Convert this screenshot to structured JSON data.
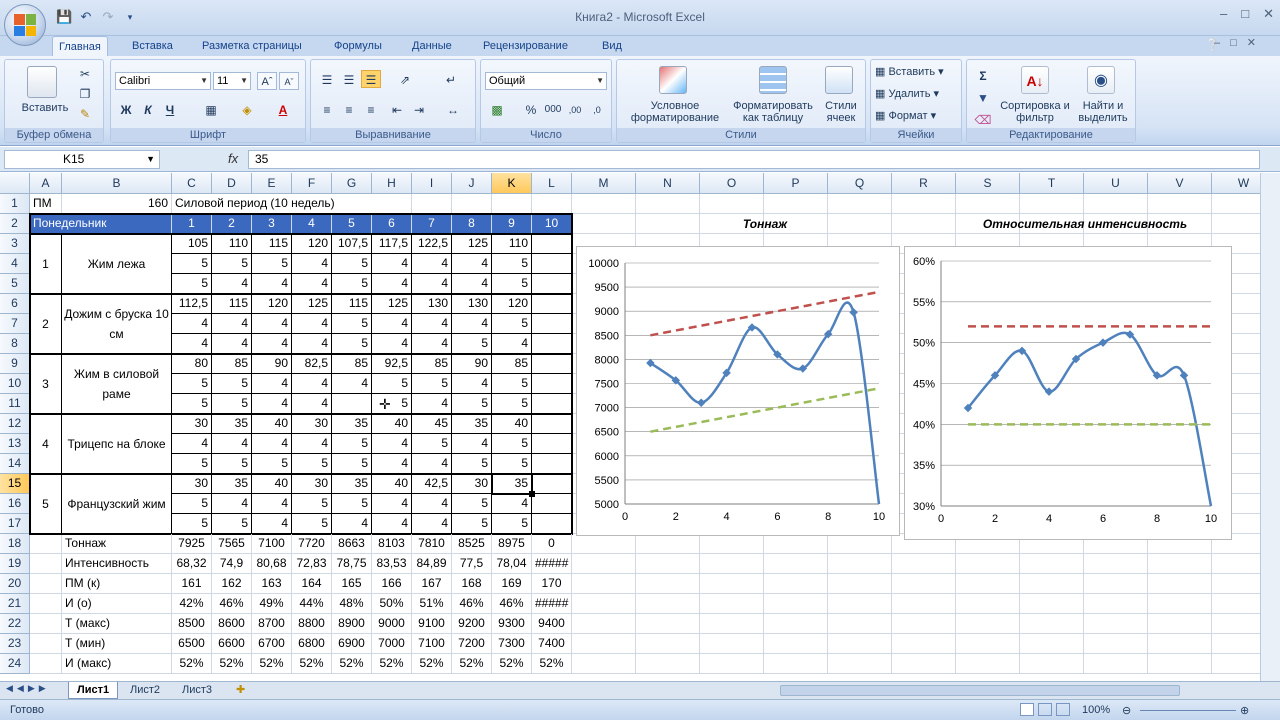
{
  "window": {
    "title": "Книга2 - Microsoft Excel"
  },
  "tabs": [
    "Главная",
    "Вставка",
    "Разметка страницы",
    "Формулы",
    "Данные",
    "Рецензирование",
    "Вид"
  ],
  "ribbon": {
    "clipboard": {
      "label": "Буфер обмена",
      "paste": "Вставить"
    },
    "font": {
      "label": "Шрифт",
      "name": "Calibri",
      "size": "11",
      "bold": "Ж",
      "italic": "К",
      "underline": "Ч"
    },
    "alignment": {
      "label": "Выравнивание"
    },
    "number": {
      "label": "Число",
      "format": "Общий"
    },
    "styles": {
      "label": "Стили",
      "conditional": "Условное форматирование",
      "table": "Форматировать как таблицу",
      "cell": "Стили ячеек"
    },
    "cells": {
      "label": "Ячейки",
      "insert": "Вставить",
      "delete": "Удалить",
      "format": "Формат"
    },
    "editing": {
      "label": "Редактирование",
      "sort": "Сортировка и фильтр",
      "find": "Найти и выделить"
    }
  },
  "formula_bar": {
    "name": "K15",
    "fx": "fx",
    "value": "35"
  },
  "columns": [
    "A",
    "B",
    "C",
    "D",
    "E",
    "F",
    "G",
    "H",
    "I",
    "J",
    "K",
    "L",
    "M",
    "N",
    "O",
    "P",
    "Q",
    "R",
    "S",
    "T",
    "U",
    "V",
    "W"
  ],
  "rows": [
    "1",
    "2",
    "3",
    "4",
    "5",
    "6",
    "7",
    "8",
    "9",
    "10",
    "11",
    "12",
    "13",
    "14",
    "15",
    "16",
    "17",
    "18",
    "19",
    "20",
    "21",
    "22",
    "23",
    "24"
  ],
  "sheet": {
    "r1": {
      "a": "ПМ",
      "b": "160",
      "c": "Силовой период (10 недель)"
    },
    "header": {
      "a": "Понедельник",
      "weeks": [
        "1",
        "2",
        "3",
        "4",
        "5",
        "6",
        "7",
        "8",
        "9",
        "10"
      ]
    },
    "exercises": [
      {
        "num": "1",
        "name": "Жим лежа",
        "rows": [
          [
            "105",
            "110",
            "115",
            "120",
            "107,5",
            "117,5",
            "122,5",
            "125",
            "110",
            ""
          ],
          [
            "5",
            "5",
            "5",
            "4",
            "5",
            "4",
            "4",
            "4",
            "5",
            ""
          ],
          [
            "5",
            "4",
            "4",
            "4",
            "5",
            "4",
            "4",
            "4",
            "5",
            ""
          ]
        ]
      },
      {
        "num": "2",
        "name": "Дожим с бруска 10 см",
        "rows": [
          [
            "112,5",
            "115",
            "120",
            "125",
            "115",
            "125",
            "130",
            "130",
            "120",
            ""
          ],
          [
            "4",
            "4",
            "4",
            "4",
            "5",
            "4",
            "4",
            "4",
            "5",
            ""
          ],
          [
            "4",
            "4",
            "4",
            "4",
            "5",
            "4",
            "4",
            "5",
            "4",
            ""
          ]
        ]
      },
      {
        "num": "3",
        "name": "Жим в силовой раме",
        "rows": [
          [
            "80",
            "85",
            "90",
            "82,5",
            "85",
            "92,5",
            "85",
            "90",
            "85",
            ""
          ],
          [
            "5",
            "5",
            "4",
            "4",
            "4",
            "5",
            "5",
            "4",
            "5",
            ""
          ],
          [
            "5",
            "5",
            "4",
            "4",
            "",
            "5",
            "4",
            "5",
            "5",
            ""
          ]
        ]
      },
      {
        "num": "4",
        "name": "Трицепс на блоке",
        "rows": [
          [
            "30",
            "35",
            "40",
            "30",
            "35",
            "40",
            "45",
            "35",
            "40",
            ""
          ],
          [
            "4",
            "4",
            "4",
            "4",
            "5",
            "4",
            "5",
            "4",
            "5",
            ""
          ],
          [
            "5",
            "5",
            "5",
            "5",
            "5",
            "4",
            "4",
            "5",
            "5",
            ""
          ]
        ]
      },
      {
        "num": "5",
        "name": "Французский жим",
        "rows": [
          [
            "30",
            "35",
            "40",
            "30",
            "35",
            "40",
            "42,5",
            "30",
            "35",
            ""
          ],
          [
            "5",
            "4",
            "4",
            "5",
            "5",
            "4",
            "4",
            "5",
            "4",
            ""
          ],
          [
            "5",
            "5",
            "4",
            "5",
            "4",
            "4",
            "4",
            "5",
            "5",
            ""
          ]
        ]
      }
    ],
    "summary": [
      {
        "label": "Тоннаж",
        "values": [
          "7925",
          "7565",
          "7100",
          "7720",
          "8663",
          "8103",
          "7810",
          "8525",
          "8975",
          "0"
        ]
      },
      {
        "label": "Интенсивность",
        "values": [
          "68,32",
          "74,9",
          "80,68",
          "72,83",
          "78,75",
          "83,53",
          "84,89",
          "77,5",
          "78,04",
          "#####"
        ]
      },
      {
        "label": "ПМ (к)",
        "values": [
          "161",
          "162",
          "163",
          "164",
          "165",
          "166",
          "167",
          "168",
          "169",
          "170"
        ]
      },
      {
        "label": "И (о)",
        "values": [
          "42%",
          "46%",
          "49%",
          "44%",
          "48%",
          "50%",
          "51%",
          "46%",
          "46%",
          "#####"
        ]
      },
      {
        "label": "Т (макс)",
        "values": [
          "8500",
          "8600",
          "8700",
          "8800",
          "8900",
          "9000",
          "9100",
          "9200",
          "9300",
          "9400"
        ]
      },
      {
        "label": "Т (мин)",
        "values": [
          "6500",
          "6600",
          "6700",
          "6800",
          "6900",
          "7000",
          "7100",
          "7200",
          "7300",
          "7400"
        ]
      },
      {
        "label": "И (макс)",
        "values": [
          "52%",
          "52%",
          "52%",
          "52%",
          "52%",
          "52%",
          "52%",
          "52%",
          "52%",
          "52%"
        ]
      }
    ]
  },
  "chart_data": [
    {
      "type": "line",
      "title": "Тоннаж",
      "xlim": [
        0,
        10
      ],
      "ylim": [
        5000,
        10000
      ],
      "xticks": [
        "0",
        "2",
        "4",
        "6",
        "8",
        "10"
      ],
      "yticks": [
        "5000",
        "5500",
        "6000",
        "6500",
        "7000",
        "7500",
        "8000",
        "8500",
        "9000",
        "9500",
        "10000"
      ],
      "x": [
        1,
        2,
        3,
        4,
        5,
        6,
        7,
        8,
        9,
        10
      ],
      "series": [
        {
          "color": "#4f81bd",
          "smooth": true,
          "markers": true,
          "values": [
            7925,
            7565,
            7100,
            7720,
            8663,
            8103,
            7810,
            8525,
            8975,
            0
          ]
        },
        {
          "color": "#c0504d",
          "dashed": true,
          "values": [
            8500,
            8600,
            8700,
            8800,
            8900,
            9000,
            9100,
            9200,
            9300,
            9400
          ]
        },
        {
          "color": "#9bbb59",
          "dashed": true,
          "values": [
            6500,
            6600,
            6700,
            6800,
            6900,
            7000,
            7100,
            7200,
            7300,
            7400
          ]
        }
      ]
    },
    {
      "type": "line",
      "title": "Относительная интенсивность",
      "xlim": [
        0,
        10
      ],
      "ylim": [
        0.3,
        0.6
      ],
      "xticks": [
        "0",
        "2",
        "4",
        "6",
        "8",
        "10"
      ],
      "yticks": [
        "30%",
        "35%",
        "40%",
        "45%",
        "50%",
        "55%",
        "60%"
      ],
      "x": [
        1,
        2,
        3,
        4,
        5,
        6,
        7,
        8,
        9,
        10
      ],
      "series": [
        {
          "color": "#4f81bd",
          "smooth": true,
          "markers": true,
          "values": [
            0.42,
            0.46,
            0.49,
            0.44,
            0.48,
            0.5,
            0.51,
            0.46,
            0.46,
            0
          ]
        },
        {
          "color": "#c0504d",
          "dashed": true,
          "values": [
            0.52,
            0.52,
            0.52,
            0.52,
            0.52,
            0.52,
            0.52,
            0.52,
            0.52,
            0.52
          ]
        },
        {
          "color": "#9bbb59",
          "dashed": true,
          "values": [
            0.4,
            0.4,
            0.4,
            0.4,
            0.4,
            0.4,
            0.4,
            0.4,
            0.4,
            0.4
          ]
        }
      ]
    }
  ],
  "sheet_tabs": [
    "Лист1",
    "Лист2",
    "Лист3"
  ],
  "status": {
    "ready": "Готово",
    "zoom": "100%"
  }
}
